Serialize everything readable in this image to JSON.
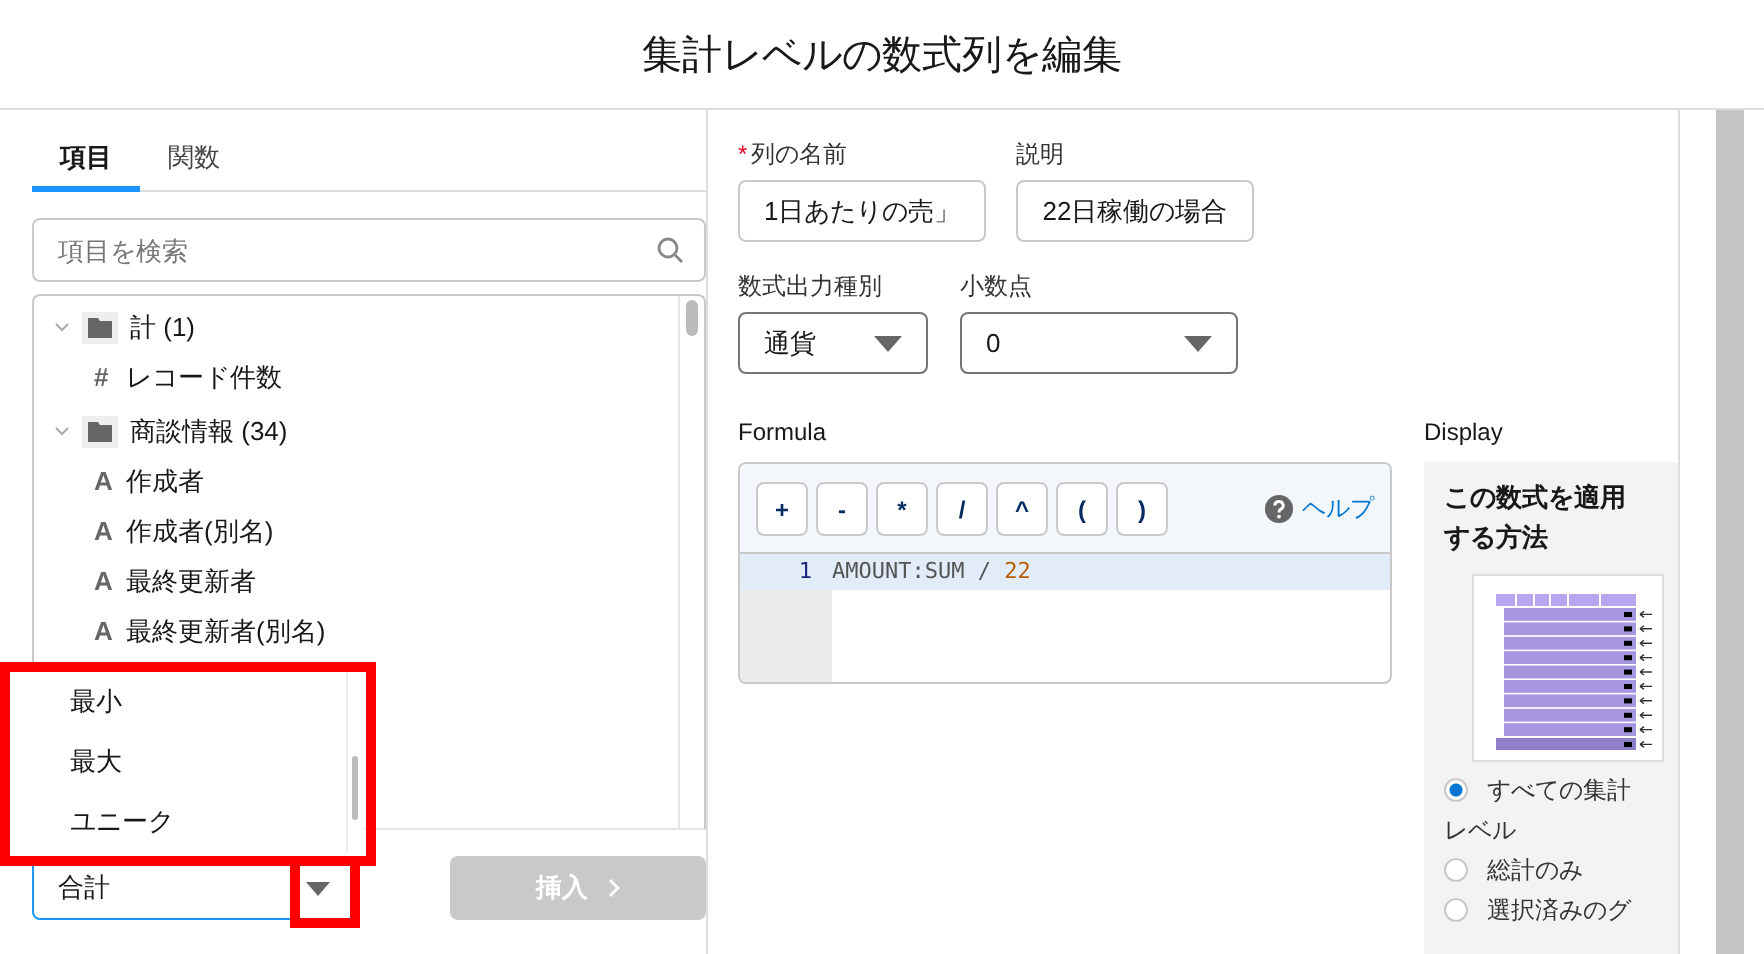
{
  "dialog": {
    "title": "集計レベルの数式列を編集"
  },
  "tabs": [
    {
      "label": "項目",
      "selected": true
    },
    {
      "label": "関数",
      "selected": false
    }
  ],
  "search": {
    "placeholder": "項目を検索"
  },
  "tree": [
    {
      "label": "計 (1)",
      "expanded": true,
      "children": [
        {
          "glyph": "#",
          "label": "レコード件数"
        }
      ]
    },
    {
      "label": "商談情報 (34)",
      "expanded": true,
      "children": [
        {
          "glyph": "A",
          "label": "作成者"
        },
        {
          "glyph": "A",
          "label": "作成者(別名)"
        },
        {
          "glyph": "A",
          "label": "最終更新者"
        },
        {
          "glyph": "A",
          "label": "最終更新者(別名)"
        }
      ]
    }
  ],
  "summary_dropdown": {
    "options": [
      "最小",
      "最大",
      "ユニーク"
    ],
    "value": "合計",
    "open": true
  },
  "insert_button": {
    "label": "挿入",
    "disabled": true
  },
  "fields": [
    {
      "label": "列の名前",
      "required": true,
      "value": "1日あたりの売」"
    },
    {
      "label": "説明",
      "required": false,
      "value": "22日稼働の場合"
    }
  ],
  "selects": [
    {
      "label": "数式出力種別",
      "value": "通貨"
    },
    {
      "label": "小数点",
      "value": "0"
    }
  ],
  "formula": {
    "label": "Formula",
    "operators": [
      "+",
      "-",
      "*",
      "/",
      "^",
      "(",
      ")"
    ],
    "help": "ヘルプ",
    "lines": [
      {
        "number": "1",
        "active": true,
        "tokens": [
          {
            "text": "AMOUNT:SUM / ",
            "kind": "plain"
          },
          {
            "text": "22",
            "kind": "number"
          }
        ]
      }
    ]
  },
  "display": {
    "label": "Display",
    "heading": "この数式を適用する方法",
    "options": [
      {
        "label": "すべての集計レベル",
        "selected": true
      },
      {
        "label": "総計のみ",
        "selected": false
      },
      {
        "label": "選択済みのグ",
        "selected": false
      }
    ]
  }
}
